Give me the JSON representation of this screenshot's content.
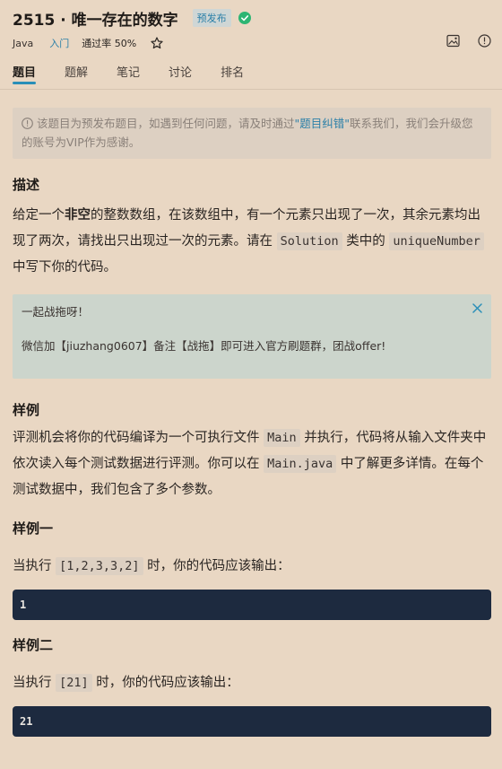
{
  "header": {
    "title": "2515 · 唯一存在的数字",
    "badge": "预发布",
    "language": "Java",
    "level": "入门",
    "pass_rate": "通过率 50%"
  },
  "tabs": [
    {
      "label": "题目",
      "active": true
    },
    {
      "label": "题解",
      "active": false
    },
    {
      "label": "笔记",
      "active": false
    },
    {
      "label": "讨论",
      "active": false
    },
    {
      "label": "排名",
      "active": false
    }
  ],
  "notice": {
    "text_before": "该题目为预发布题目，如遇到任何问题，请及时通过",
    "link": "\"题目纠错\"",
    "text_after": "联系我们，我们会升级您的账号为VIP作为感谢。"
  },
  "description": {
    "title": "描述",
    "p1": "给定一个",
    "p_bold": "非空",
    "p2": "的整数数组，在该数组中，有一个元素只出现了一次，其余元素均出现了两次，请找出只出现过一次的元素。请在 ",
    "code1": "Solution",
    "p3": " 类中的 ",
    "code2": "uniqueNumber",
    "p4": " 中写下你的代码。"
  },
  "callout": {
    "line1": "一起战拖呀！",
    "line2": "微信加【jiuzhang0607】备注【战拖】即可进入官方刷题群，团战offer!"
  },
  "samples": {
    "title": "样例",
    "d1": "评测机会将你的代码编译为一个可执行文件 ",
    "code_main": "Main",
    "d2": " 并执行，代码将从输入文件夹中依次读入每个测试数据进行评测。你可以在 ",
    "code_main_java": "Main.java",
    "d3": " 中了解更多详情。在每个测试数据中，我们包含了多个参数。",
    "items": [
      {
        "title": "样例一",
        "exec_before": "当执行 ",
        "input": "[1,2,3,3,2]",
        "exec_after": " 时，你的代码应该输出：",
        "output": "1"
      },
      {
        "title": "样例二",
        "exec_before": "当执行 ",
        "input": "[21]",
        "exec_after": " 时，你的代码应该输出：",
        "output": "21"
      }
    ]
  },
  "colors": {
    "background": "#e9d7c3",
    "accent": "#2a8fb8",
    "success": "#2db573",
    "code_block": "#1d2a3f"
  },
  "icons": [
    "check-circle-icon",
    "star-icon",
    "image-icon",
    "info-icon",
    "close-icon"
  ]
}
